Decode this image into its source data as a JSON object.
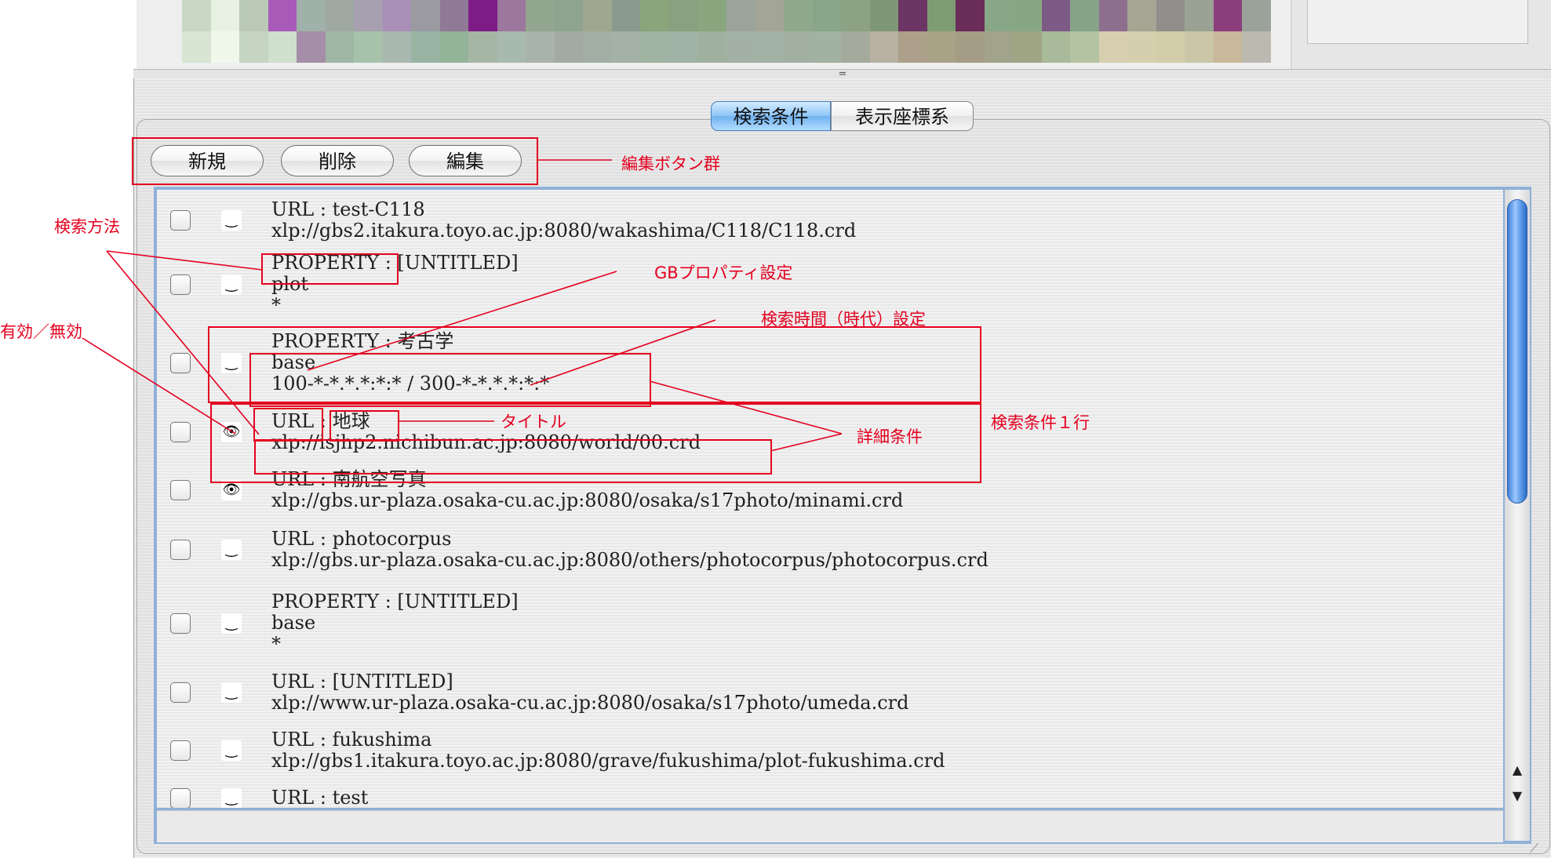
{
  "tabs": [
    {
      "label": "検索条件",
      "active": true
    },
    {
      "label": "表示座標系",
      "active": false
    }
  ],
  "edit_buttons": {
    "new": "新規",
    "delete": "削除",
    "edit": "編集"
  },
  "divider_grip": "=",
  "rows": [
    {
      "line1": "URL : test-C118",
      "line2": "xlp://gbs2.itakura.toyo.ac.jp:8080/wakashima/C118/C118.crd",
      "line3": "",
      "visible": false
    },
    {
      "line1": "PROPERTY : [UNTITLED]",
      "line2": "plot",
      "line3": "*",
      "visible": false
    },
    {
      "line1": "PROPERTY : 考古学",
      "line2": "base",
      "line3": "100-*-*.*.*:*:* / 300-*-*.*.*:*:*",
      "visible": false
    },
    {
      "line1": "URL : 地球",
      "line2": "xlp://isjhp2.nichibun.ac.jp:8080/world/00.crd",
      "line3": "",
      "visible": true
    },
    {
      "line1": "URL : 南航空写真",
      "line2": "xlp://gbs.ur-plaza.osaka-cu.ac.jp:8080/osaka/s17photo/minami.crd",
      "line3": "",
      "visible": true
    },
    {
      "line1": "URL : photocorpus",
      "line2": "xlp://gbs.ur-plaza.osaka-cu.ac.jp:8080/others/photocorpus/photocorpus.crd",
      "line3": "",
      "visible": false
    },
    {
      "line1": "PROPERTY : [UNTITLED]",
      "line2": "base",
      "line3": "*",
      "visible": false
    },
    {
      "line1": "URL : [UNTITLED]",
      "line2": "xlp://www.ur-plaza.osaka-cu.ac.jp:8080/osaka/s17photo/umeda.crd",
      "line3": "",
      "visible": false
    },
    {
      "line1": "URL : fukushima",
      "line2": "xlp://gbs1.itakura.toyo.ac.jp:8080/grave/fukushima/plot-fukushima.crd",
      "line3": "",
      "visible": false
    },
    {
      "line1": "URL : test",
      "line2": "",
      "line3": "",
      "visible": false
    }
  ],
  "icons": {
    "visible": "eye-icon",
    "hidden": "closed-eye-icon",
    "scroll_up": "arrow-up-icon",
    "scroll_down": "arrow-down-icon"
  },
  "annotations": {
    "edit_buttons": "編集ボタン群",
    "search_method": "検索方法",
    "enable_disable": "有効／無効",
    "gb_property": "GBプロパティ設定",
    "search_time": "検索時間（時代）設定",
    "title": "タイトル",
    "detail": "詳細条件",
    "one_row": "検索条件１行"
  },
  "annotation_color": "#e4001f",
  "accent_color": "#6fb2f0",
  "mosaic_colors": [
    [
      "#c9d8c4",
      "#e7f2e2",
      "#b9c9b6",
      "#a85ab9",
      "#9fb1a8",
      "#9fa8a2",
      "#a7a0b1",
      "#a88fb6",
      "#9b9aa1",
      "#8e7a95",
      "#7e1c85",
      "#9c789e",
      "#93a68f",
      "#8fa48e",
      "#9fa88f",
      "#8a9a8c",
      "#8aa47b",
      "#8aa07e",
      "#8aa67e",
      "#9aa49a",
      "#a3a596",
      "#8ea98b",
      "#8aa68a",
      "#8da183",
      "#7f9776",
      "#6b3564",
      "#7e9c74",
      "#6a2c58",
      "#88a786",
      "#87a784",
      "#7d5b86",
      "#86a389",
      "#8d6e8c",
      "#a4a593",
      "#8f8e8a",
      "#9aa294",
      "#8c3e7c",
      "#9aa29a"
    ],
    [
      "#d7e5d2",
      "#f0f8ec",
      "#c5d5c2",
      "#cfe0cc",
      "#a58fa8",
      "#9fb6a5",
      "#a7c2ab",
      "#a9b8b1",
      "#9ab4a4",
      "#94b49a",
      "#a6b6a4",
      "#a8b9ad",
      "#a8b3ab",
      "#a1aba3",
      "#a3afa5",
      "#a3b2a5",
      "#9fb4a2",
      "#a0b3a5",
      "#9fb09f",
      "#a2b1a4",
      "#a2b2a5",
      "#a2b0a1",
      "#a2b2a2",
      "#a4ab9d",
      "#b9b1a1",
      "#aca08a",
      "#a8a287",
      "#a49c85",
      "#a1a48a",
      "#9fa484",
      "#a8ba99",
      "#b4c3a2",
      "#d8ceb0",
      "#d6cfae",
      "#d3cda9",
      "#cbc6a7",
      "#c9b89a",
      "#bcbab0"
    ]
  ]
}
